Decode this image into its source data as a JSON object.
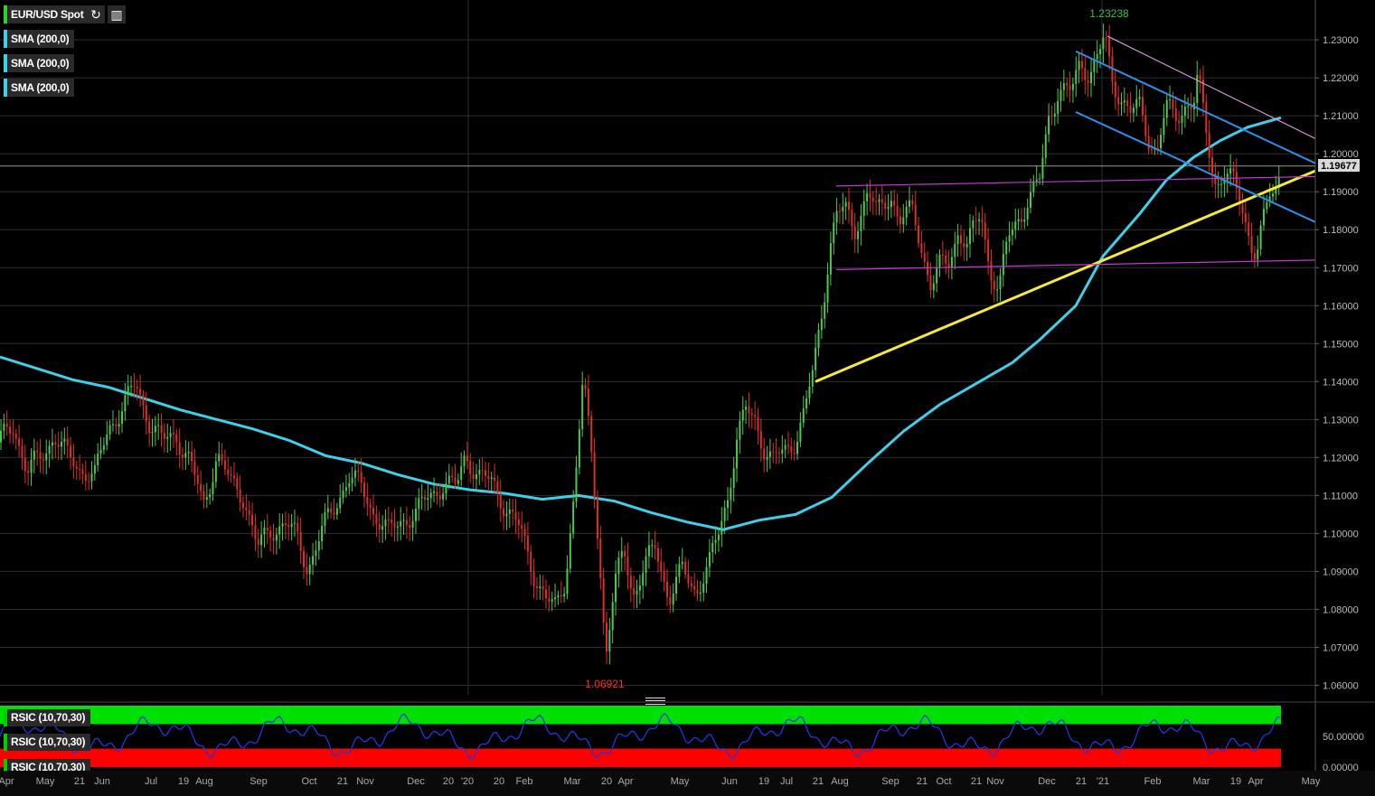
{
  "header": {
    "symbol": "EUR/USD Spot",
    "refresh_icon": "refresh-icon",
    "settings_icon": "chart-settings-icon",
    "indicators": [
      "SMA (200,0)",
      "SMA (200,0)",
      "SMA (200,0)"
    ],
    "sub_indicators": [
      "RSIC (10,70,30)",
      "RSIC (10,70,30)",
      "RSIC (10,70,30)"
    ]
  },
  "colors": {
    "up": "#4ec94e",
    "down": "#d9302b",
    "sma": "#3ed0e8",
    "trend_yellow": "#f6e93a",
    "channel_blue": "#2e8fe8",
    "range_magenta": "#c03ad0",
    "resistance_pink": "#d49ad8",
    "rsi_line": "#2236e0",
    "rsi_over": "#00e000",
    "rsi_under": "#ff0000"
  },
  "chart_data": {
    "type": "candlestick",
    "title": "EUR/USD Spot",
    "price_axis_ticks": [
      "1.23000",
      "1.22000",
      "1.21000",
      "1.20000",
      "1.19000",
      "1.18000",
      "1.17000",
      "1.16000",
      "1.15000",
      "1.14000",
      "1.13000",
      "1.12000",
      "1.11000",
      "1.10000",
      "1.09000",
      "1.08000",
      "1.07000",
      "1.06000"
    ],
    "ylim": [
      1.0575,
      1.2405
    ],
    "current_price": "1.19677",
    "annotations": {
      "high": "1.23238",
      "low": "1.06921"
    },
    "time_axis_labels": [
      "Apr",
      "May",
      "21",
      "Jun",
      "Jul",
      "19",
      "Aug",
      "Sep",
      "Oct",
      "21",
      "Nov",
      "Dec",
      "20",
      "'20",
      "20",
      "Feb",
      "Mar",
      "20",
      "Apr",
      "May",
      "Jun",
      "19",
      "Jul",
      "21",
      "Aug",
      "Sep",
      "21",
      "Oct",
      "21",
      "Nov",
      "Dec",
      "21",
      "'21",
      "Feb",
      "Mar",
      "19",
      "Apr",
      "May"
    ],
    "close_path": [
      [
        0,
        1.124
      ],
      [
        15,
        1.129
      ],
      [
        30,
        1.116
      ],
      [
        45,
        1.12
      ],
      [
        60,
        1.126
      ],
      [
        75,
        1.12
      ],
      [
        90,
        1.117
      ],
      [
        105,
        1.115
      ],
      [
        120,
        1.128
      ],
      [
        135,
        1.133
      ],
      [
        150,
        1.139
      ],
      [
        165,
        1.13
      ],
      [
        180,
        1.124
      ],
      [
        195,
        1.126
      ],
      [
        210,
        1.119
      ],
      [
        225,
        1.107
      ],
      [
        240,
        1.121
      ],
      [
        255,
        1.113
      ],
      [
        270,
        1.11
      ],
      [
        285,
        1.096
      ],
      [
        300,
        1.101
      ],
      [
        315,
        1.103
      ],
      [
        330,
        1.098
      ],
      [
        340,
        1.091
      ],
      [
        355,
        1.1
      ],
      [
        370,
        1.107
      ],
      [
        385,
        1.115
      ],
      [
        400,
        1.112
      ],
      [
        415,
        1.105
      ],
      [
        430,
        1.1
      ],
      [
        445,
        1.104
      ],
      [
        460,
        1.105
      ],
      [
        475,
        1.11
      ],
      [
        490,
        1.113
      ],
      [
        505,
        1.112
      ],
      [
        515,
        1.121
      ],
      [
        530,
        1.115
      ],
      [
        545,
        1.113
      ],
      [
        560,
        1.107
      ],
      [
        575,
        1.101
      ],
      [
        590,
        1.09
      ],
      [
        605,
        1.082
      ],
      [
        615,
        1.08
      ],
      [
        625,
        1.088
      ],
      [
        635,
        1.11
      ],
      [
        645,
        1.14
      ],
      [
        655,
        1.12
      ],
      [
        662,
        1.098
      ],
      [
        670,
        1.068
      ],
      [
        680,
        1.085
      ],
      [
        690,
        1.097
      ],
      [
        700,
        1.084
      ],
      [
        712,
        1.09
      ],
      [
        725,
        1.097
      ],
      [
        740,
        1.083
      ],
      [
        755,
        1.09
      ],
      [
        770,
        1.085
      ],
      [
        785,
        1.092
      ],
      [
        795,
        1.1
      ],
      [
        805,
        1.11
      ],
      [
        815,
        1.125
      ],
      [
        825,
        1.132
      ],
      [
        835,
        1.13
      ],
      [
        845,
        1.123
      ],
      [
        855,
        1.119
      ],
      [
        870,
        1.122
      ],
      [
        880,
        1.125
      ],
      [
        890,
        1.132
      ],
      [
        900,
        1.143
      ],
      [
        910,
        1.16
      ],
      [
        918,
        1.176
      ],
      [
        925,
        1.184
      ],
      [
        935,
        1.185
      ],
      [
        945,
        1.18
      ],
      [
        960,
        1.19
      ],
      [
        970,
        1.184
      ],
      [
        985,
        1.19
      ],
      [
        995,
        1.182
      ],
      [
        1010,
        1.185
      ],
      [
        1020,
        1.175
      ],
      [
        1030,
        1.165
      ],
      [
        1040,
        1.17
      ],
      [
        1050,
        1.172
      ],
      [
        1060,
        1.18
      ],
      [
        1070,
        1.175
      ],
      [
        1085,
        1.185
      ],
      [
        1095,
        1.17
      ],
      [
        1105,
        1.163
      ],
      [
        1115,
        1.178
      ],
      [
        1125,
        1.183
      ],
      [
        1140,
        1.188
      ],
      [
        1150,
        1.193
      ],
      [
        1160,
        1.21
      ],
      [
        1170,
        1.216
      ],
      [
        1185,
        1.216
      ],
      [
        1195,
        1.225
      ],
      [
        1205,
        1.221
      ],
      [
        1215,
        1.225
      ],
      [
        1222,
        1.231
      ],
      [
        1230,
        1.22
      ],
      [
        1240,
        1.215
      ],
      [
        1250,
        1.21
      ],
      [
        1260,
        1.213
      ],
      [
        1270,
        1.205
      ],
      [
        1280,
        1.2
      ],
      [
        1290,
        1.212
      ],
      [
        1300,
        1.21
      ],
      [
        1310,
        1.213
      ],
      [
        1320,
        1.212
      ],
      [
        1325,
        1.22
      ],
      [
        1335,
        1.205
      ],
      [
        1345,
        1.192
      ],
      [
        1355,
        1.194
      ],
      [
        1365,
        1.192
      ],
      [
        1375,
        1.186
      ],
      [
        1385,
        1.175
      ],
      [
        1390,
        1.173
      ],
      [
        1398,
        1.182
      ],
      [
        1405,
        1.19
      ],
      [
        1412,
        1.192
      ],
      [
        1417,
        1.19677
      ]
    ],
    "sma_path": [
      [
        0,
        1.1465
      ],
      [
        40,
        1.1435
      ],
      [
        80,
        1.1405
      ],
      [
        120,
        1.1385
      ],
      [
        160,
        1.1355
      ],
      [
        200,
        1.1325
      ],
      [
        240,
        1.13
      ],
      [
        280,
        1.1275
      ],
      [
        320,
        1.1245
      ],
      [
        360,
        1.1205
      ],
      [
        400,
        1.1185
      ],
      [
        440,
        1.1155
      ],
      [
        480,
        1.113
      ],
      [
        520,
        1.1115
      ],
      [
        560,
        1.1105
      ],
      [
        600,
        1.109
      ],
      [
        640,
        1.11
      ],
      [
        680,
        1.1085
      ],
      [
        720,
        1.1055
      ],
      [
        760,
        1.103
      ],
      [
        800,
        1.101
      ],
      [
        840,
        1.1035
      ],
      [
        880,
        1.105
      ],
      [
        920,
        1.1095
      ],
      [
        960,
        1.1185
      ],
      [
        1000,
        1.127
      ],
      [
        1040,
        1.134
      ],
      [
        1080,
        1.1395
      ],
      [
        1120,
        1.145
      ],
      [
        1150,
        1.151
      ],
      [
        1190,
        1.16
      ],
      [
        1220,
        1.173
      ],
      [
        1260,
        1.184
      ],
      [
        1290,
        1.193
      ],
      [
        1320,
        1.199
      ],
      [
        1350,
        1.2035
      ],
      [
        1380,
        1.207
      ],
      [
        1417,
        1.2095
      ]
    ],
    "trendlines": [
      {
        "name": "yellow-support",
        "color": "trend_yellow",
        "from": [
          902,
          1.14
        ],
        "to": [
          1455,
          1.1955
        ]
      },
      {
        "name": "channel-upper",
        "color": "channel_blue",
        "from": [
          1190,
          1.227
        ],
        "to": [
          1455,
          1.1975
        ]
      },
      {
        "name": "channel-lower",
        "color": "channel_blue",
        "from": [
          1190,
          1.211
        ],
        "to": [
          1455,
          1.182
        ]
      },
      {
        "name": "range-top",
        "color": "range_magenta",
        "from": [
          925,
          1.1915
        ],
        "to": [
          1455,
          1.194
        ]
      },
      {
        "name": "range-bottom",
        "color": "range_magenta",
        "from": [
          925,
          1.1695
        ],
        "to": [
          1455,
          1.172
        ]
      },
      {
        "name": "resistance",
        "color": "resistance_pink",
        "from": [
          1225,
          1.231
        ],
        "to": [
          1455,
          1.204
        ]
      }
    ],
    "rsi": {
      "axis_ticks": [
        "50.00000",
        "0.00000"
      ],
      "overbought": 70,
      "oversold": 30,
      "ylim": [
        0,
        100
      ]
    }
  }
}
